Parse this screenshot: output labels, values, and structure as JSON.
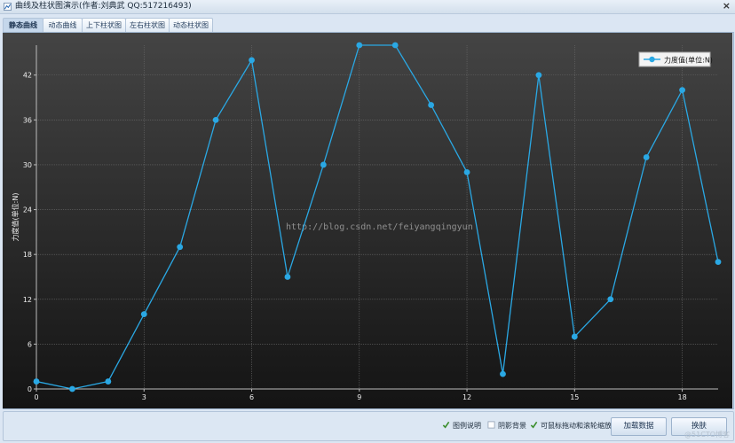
{
  "window": {
    "title": "曲线及柱状图演示(作者:刘典武 QQ:517216493)",
    "close_glyph": "×"
  },
  "tabs": [
    {
      "label": "静态曲线",
      "active": true
    },
    {
      "label": "动态曲线",
      "active": false
    },
    {
      "label": "上下柱状图",
      "active": false
    },
    {
      "label": "左右柱状图",
      "active": false
    },
    {
      "label": "动态柱状图",
      "active": false
    }
  ],
  "chart_data": {
    "type": "line",
    "ylabel": "力度值(单位:N)",
    "xlabel": "",
    "xlim": [
      0,
      19
    ],
    "ylim": [
      0,
      46
    ],
    "x_ticks": [
      0,
      3,
      6,
      9,
      12,
      15,
      18
    ],
    "y_ticks": [
      0,
      6,
      12,
      18,
      24,
      30,
      36,
      42
    ],
    "grid": true,
    "legend_position": "top-right",
    "watermark": "http://blog.csdn.net/feiyangqingyun",
    "series": [
      {
        "name": "力度值(单位:N)",
        "color": "#2aa8e4",
        "x": [
          0,
          1,
          2,
          3,
          4,
          5,
          6,
          7,
          8,
          9,
          10,
          11,
          12,
          13,
          14,
          15,
          16,
          17,
          18,
          19
        ],
        "values": [
          1,
          0,
          1,
          10,
          19,
          36,
          44,
          15,
          30,
          46,
          46,
          38,
          29,
          2,
          42,
          7,
          12,
          31,
          40,
          17
        ]
      }
    ]
  },
  "controls": {
    "legend_checkbox": {
      "label": "图例说明",
      "checked": true
    },
    "shadow_checkbox": {
      "label": "阴影背景",
      "checked": false
    },
    "zoom_checkbox": {
      "label": "可鼠标拖动和滚轮缩放",
      "checked": true
    },
    "load_button": "加载数据",
    "skin_button": "换肤"
  },
  "corner_watermark": "@51CTO博客",
  "colors": {
    "plot_bg_top": "#444444",
    "plot_bg_bottom": "#141414",
    "line": "#2aa8e4",
    "grid": "#6a6a6a",
    "window_bg": "#dbe6f3"
  }
}
